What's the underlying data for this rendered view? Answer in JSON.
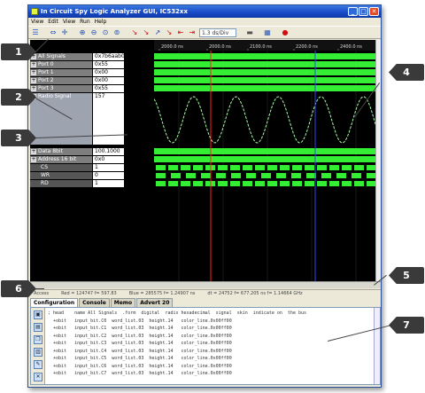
{
  "window": {
    "title": "In Circuit Spy Logic Analyzer GUI, IC532xx",
    "buttons": {
      "minimize": "_",
      "maximize": "□",
      "close": "✕"
    }
  },
  "menu": [
    "View",
    "Edit",
    "View",
    "Run",
    "Help"
  ],
  "toolbar": {
    "icons": [
      "open-icon",
      "arrow-left-right-icon",
      "arrow-cross-icon",
      "zoom-in-icon",
      "zoom-out-icon",
      "zoom-fit-icon",
      "zoom-area-icon",
      "trigger-icon",
      "trigger-icon",
      "trigger-icon",
      "red-marker-icon",
      "arrows-icon",
      "window-icon",
      "calculator-icon",
      "record-icon"
    ],
    "zoom_value": "1.3 ds/Div"
  },
  "timeline": {
    "labels": [
      "2000.0 ns",
      "2000.0 ns",
      "2100.0 ns",
      "2200.0 ns",
      "2400.0 ns"
    ]
  },
  "signals": [
    {
      "name": "All Signals",
      "value": "0x7b6aab00",
      "expand": "+"
    },
    {
      "name": "Port 0",
      "value": "0x55",
      "expand": "+"
    },
    {
      "name": "Port 1",
      "value": "0x00",
      "expand": "+"
    },
    {
      "name": "Port 2",
      "value": "0x00",
      "expand": "+"
    },
    {
      "name": "Port 3",
      "value": "0x55",
      "expand": "+"
    },
    {
      "name": "Radio Signal",
      "value": "157",
      "expand": "+"
    },
    {
      "name": "Data 8bit",
      "value": "100.1000",
      "expand": "+"
    },
    {
      "name": "Address 16 bit",
      "value": "0x0",
      "expand": "+"
    },
    {
      "name": "CS",
      "value": "1",
      "expand": ""
    },
    {
      "name": "WR",
      "value": "0",
      "expand": ""
    },
    {
      "name": "RD",
      "value": "1",
      "expand": ""
    }
  ],
  "status": {
    "left": "Access",
    "red": "Red = 124747 f= 597.83",
    "blue": "Blue = 285575 f= 1.24907 ns",
    "delta": "dt = 24752 f= 677.205 ns f= 1.14664 GHz"
  },
  "tabs": [
    "Configuration",
    "Console",
    "Memo",
    "Advert 20"
  ],
  "console_sidebar_icons": [
    "save-icon",
    "print-icon",
    "copy-icon",
    "paste-icon",
    "clear-icon",
    "clear-icon"
  ],
  "console": {
    "lines": [
      "; head    name All Signals  .form  digital  radix hexadecimal  signal  skin  indicate on  the bus",
      "  +obit   input_bit.C0  word_list.03  height.14   color_line.0x00ff00",
      "  +obit   input_bit.C1  word_list.03  height.14   color_line.0x00ff00",
      "  +obit   input_bit.C2  word_list.03  height.14   color_line.0x00ff00",
      "  +obit   input_bit.C3  word_list.03  height.14   color_line.0x00ff00",
      "  +obit   input_bit.C4  word_list.03  height.14   color_line.0x00ff00",
      "  +obit   input_bit.C5  word_list.03  height.14   color_line.0x00ff00",
      "  +obit   input_bit.C6  word_list.03  height.14   color_line.0x00ff00",
      "  +obit   input_bit.C7  word_list.03  height.14   color_line.0x00ff00"
    ]
  },
  "callouts": [
    {
      "id": "1",
      "side": "left"
    },
    {
      "id": "2",
      "side": "left"
    },
    {
      "id": "3",
      "side": "left"
    },
    {
      "id": "4",
      "side": "right"
    },
    {
      "id": "5",
      "side": "right"
    },
    {
      "id": "6",
      "side": "left"
    },
    {
      "id": "7",
      "side": "right"
    }
  ],
  "colors": {
    "wave_green": "#33ee33",
    "sine": "#a8ffa8",
    "red_cursor": "#ff2020",
    "blue_cursor": "#3344ff",
    "background": "#000000",
    "callout": "#3a3a3a"
  }
}
